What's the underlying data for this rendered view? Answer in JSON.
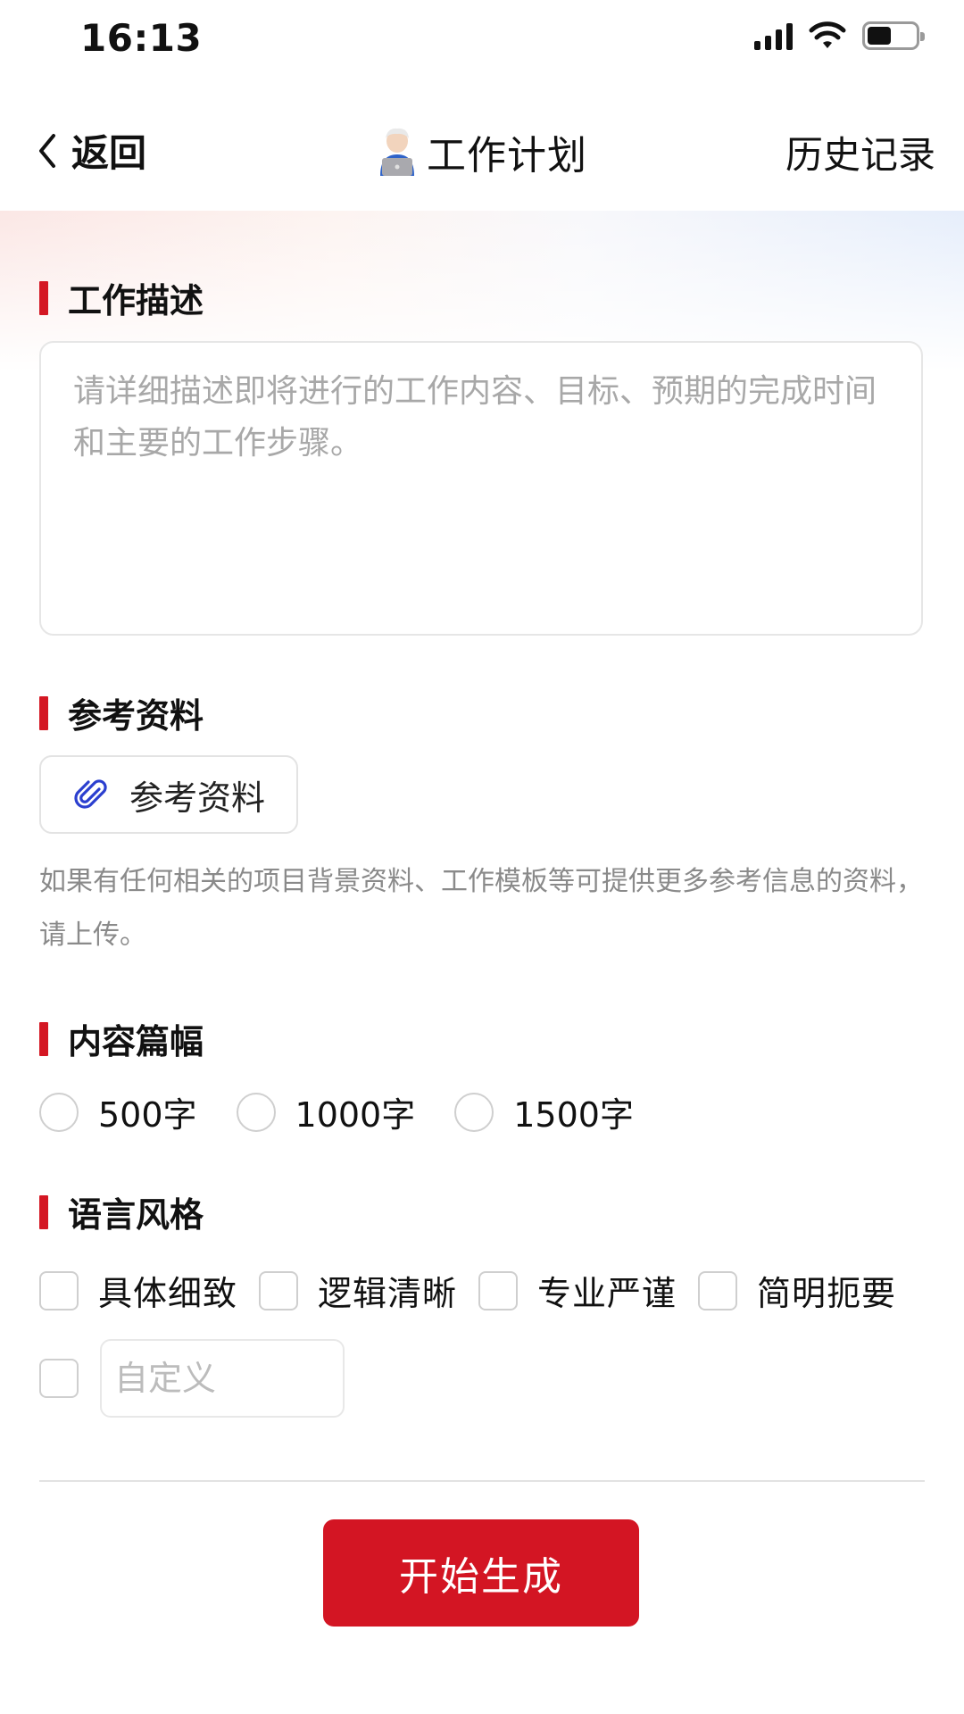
{
  "status_bar": {
    "time": "16:13",
    "icons": [
      "signal-icon",
      "wifi-icon",
      "battery-icon"
    ],
    "battery_level": 0.45
  },
  "nav": {
    "back_label": "返回",
    "title": "工作计划",
    "title_icon": "technologist-emoji-icon",
    "history_label": "历史记录"
  },
  "sections": {
    "description": {
      "title": "工作描述",
      "value": "",
      "placeholder": "请详细描述即将进行的工作内容、目标、预期的完成时间和主要的工作步骤。"
    },
    "reference": {
      "title": "参考资料",
      "button_label": "参考资料",
      "button_icon": "paperclip-icon",
      "hint": "如果有任何相关的项目背景资料、工作模板等可提供更多参考信息的资料，请上传。"
    },
    "length": {
      "title": "内容篇幅",
      "options": [
        {
          "label": "500字",
          "selected": false
        },
        {
          "label": "1000字",
          "selected": false
        },
        {
          "label": "1500字",
          "selected": false
        }
      ]
    },
    "style": {
      "title": "语言风格",
      "options": [
        {
          "label": "具体细致",
          "checked": false
        },
        {
          "label": "逻辑清晰",
          "checked": false
        },
        {
          "label": "专业严谨",
          "checked": false
        },
        {
          "label": "简明扼要",
          "checked": false
        }
      ],
      "custom": {
        "checked": false,
        "value": "",
        "placeholder": "自定义"
      }
    }
  },
  "actions": {
    "generate_label": "开始生成"
  },
  "colors": {
    "accent": "#d31523",
    "section_bar": "#d41723",
    "placeholder": "#a8a8a8",
    "hint": "#8a8a8a",
    "border": "#e3e3e3"
  }
}
